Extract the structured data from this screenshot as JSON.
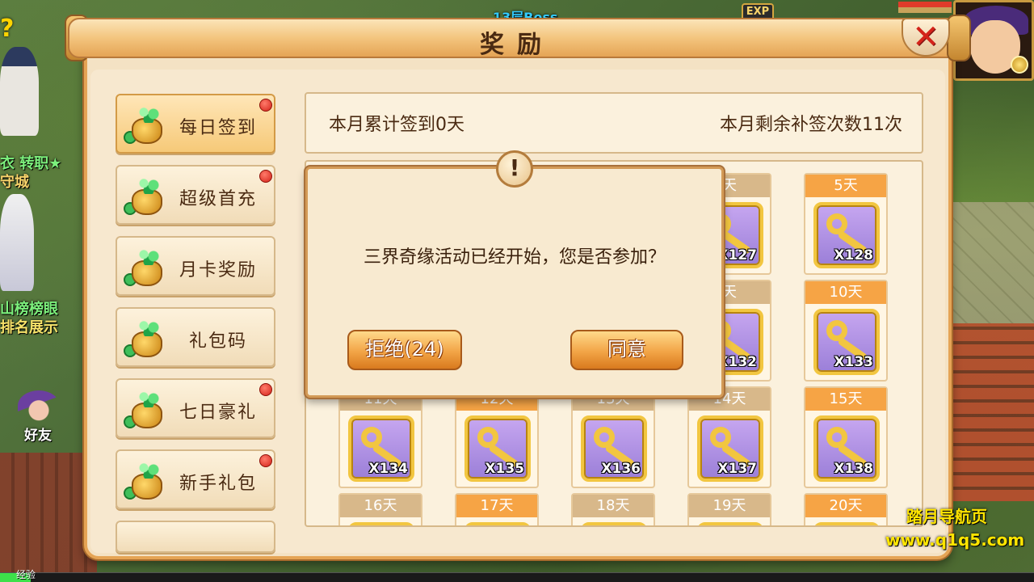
{
  "hud": {
    "boss_label": "13层Boss",
    "exp_badge": "EXP",
    "transfer_label": "衣 转职★",
    "city_label": "守城",
    "ranking_label_1": "山榜榜眼",
    "ranking_label_2": "排名展示",
    "friend_label": "好友",
    "exp_bar_label": "经验",
    "exp_progress": 0.03
  },
  "watermark": {
    "line1": "踏月导航页",
    "line2": "www.q1q5.com"
  },
  "panel": {
    "title": "奖励",
    "close_icon": "close-x-icon"
  },
  "side_menu": [
    {
      "label": "每日签到",
      "active": true,
      "red_dot": true
    },
    {
      "label": "超级首充",
      "active": false,
      "red_dot": true
    },
    {
      "label": "月卡奖励",
      "active": false,
      "red_dot": false
    },
    {
      "label": "礼包码",
      "active": false,
      "red_dot": false
    },
    {
      "label": "七日豪礼",
      "active": false,
      "red_dot": true
    },
    {
      "label": "新手礼包",
      "active": false,
      "red_dot": true
    }
  ],
  "summary": {
    "signed_days": "本月累计签到0天",
    "remaining_makeups": "本月剩余补签次数11次"
  },
  "rewards": [
    {
      "day": "天",
      "qty": "X127",
      "highlight": false
    },
    {
      "day": "5天",
      "qty": "X128",
      "highlight": true
    },
    {
      "day": "天",
      "qty": "X132",
      "highlight": false
    },
    {
      "day": "10天",
      "qty": "X133",
      "highlight": true
    },
    {
      "day": "11天",
      "qty": "X134",
      "highlight": false
    },
    {
      "day": "12天",
      "qty": "X135",
      "highlight": true
    },
    {
      "day": "13天",
      "qty": "X136",
      "highlight": false
    },
    {
      "day": "14天",
      "qty": "X137",
      "highlight": false
    },
    {
      "day": "15天",
      "qty": "X138",
      "highlight": true
    },
    {
      "day": "16天",
      "qty": "",
      "highlight": false
    },
    {
      "day": "17天",
      "qty": "",
      "highlight": true
    },
    {
      "day": "18天",
      "qty": "",
      "highlight": false
    },
    {
      "day": "19天",
      "qty": "",
      "highlight": false
    },
    {
      "day": "20天",
      "qty": "",
      "highlight": true
    }
  ],
  "dialog": {
    "badge": "!",
    "message": "三界奇缘活动已经开始，您是否参加？",
    "reject_label": "拒绝(24)",
    "agree_label": "同意"
  },
  "colors": {
    "panel_bg": "#f4e2c4",
    "accent_orange": "#f6a445",
    "close_red": "#d4231a",
    "item_purple": "#9b7fd8",
    "key_gold": "#f2c640"
  }
}
